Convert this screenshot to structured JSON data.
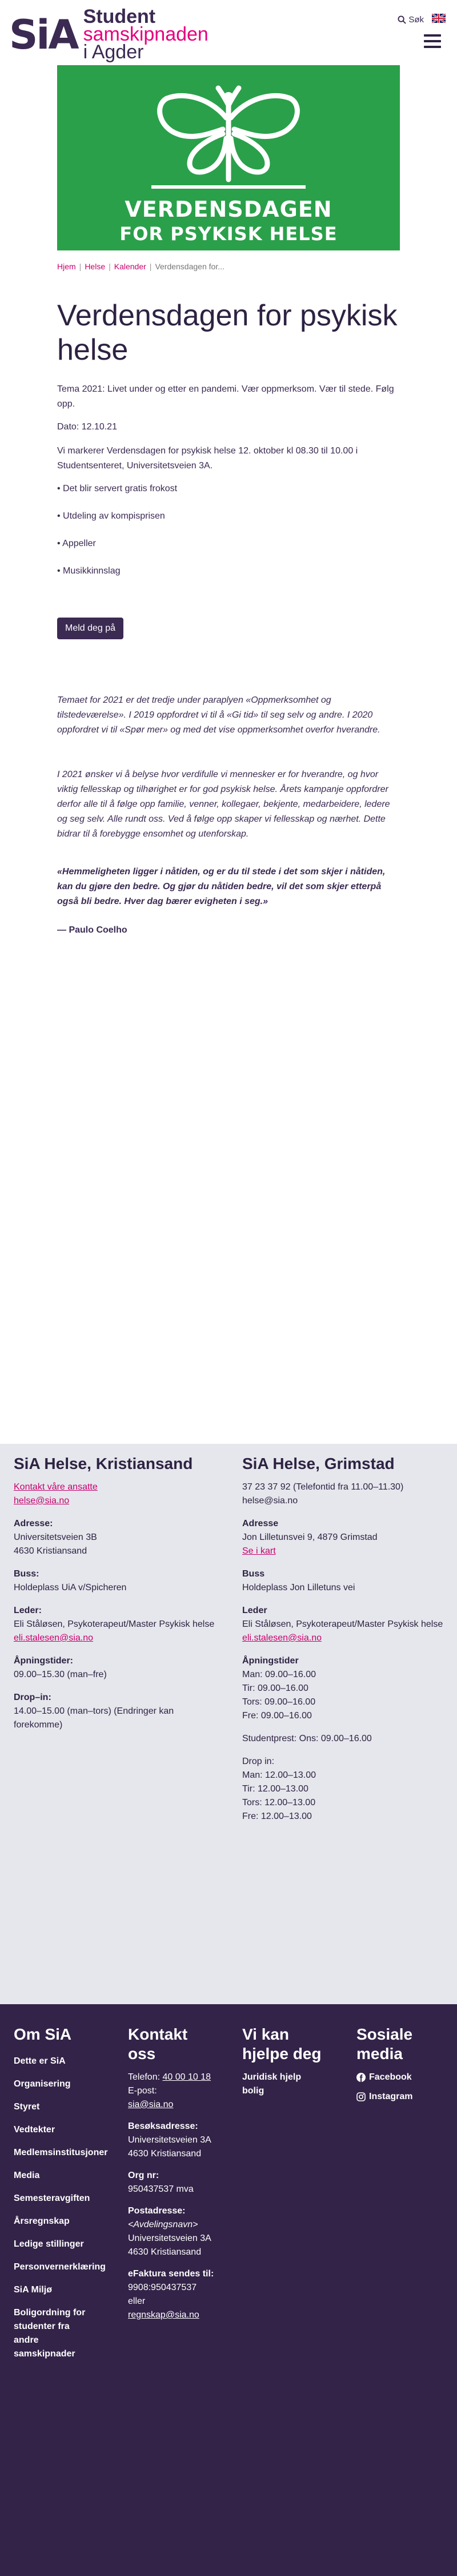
{
  "header": {
    "logo_mark": "SiA",
    "logo_line1": "Student",
    "logo_line2": "samskipnaden",
    "logo_line3": "i Agder",
    "search_label": "Søk"
  },
  "hero": {
    "line1": "VERDENSDAGEN",
    "line2": "FOR PSYKISK HELSE"
  },
  "breadcrumb": [
    "Hjem",
    "Helse",
    "Kalender",
    "Verdensdagen for..."
  ],
  "article": {
    "title": "Verdensdagen for psykisk helse",
    "intro": "Tema 2021: Livet under og etter en pandemi. Vær oppmerksom. Vær til stede. Følg opp.",
    "date": "Dato: 12.10.21",
    "body": "Vi markerer Verdensdagen for psykisk helse 12. oktober kl 08.30 til 10.00 i Studentsenteret, Universitetsveien 3A.",
    "bullets": [
      "Det blir servert gratis frokost",
      "Utdeling av kompisprisen",
      "Appeller",
      "Musikkinnslag"
    ],
    "button": "Meld deg på",
    "italic1": "Temaet for 2021 er det tredje under paraplyen «Oppmerksomhet og tilstedeværelse». I 2019 oppfordret vi til å «Gi tid» til seg selv og andre. I 2020 oppfordret vi til «Spør mer» og med det vise oppmerksomhet overfor hverandre.",
    "italic2": "I 2021 ønsker vi å belyse hvor verdifulle vi mennesker er for hverandre, og hvor viktig fellesskap og tilhørighet er for god psykisk helse. Årets kampanje oppfordrer derfor alle til å følge opp familie, venner, kollegaer, bekjente, medarbeidere, ledere og seg selv. Alle rundt oss. Ved å følge opp skaper vi fellesskap og nærhet. Dette bidrar til å forebygge ensomhet og utenforskap.",
    "quote": "«Hemmeligheten ligger i nåtiden, og er du til stede i det som skjer i nåtiden, kan du gjøre den bedre. Og gjør du nåtiden bedre, vil det som skjer etterpå også bli bedre. Hver dag bærer evigheten i seg.»",
    "author": "— Paulo Coelho"
  },
  "contact_left": {
    "title": "SiA Helse, Kristiansand",
    "contact_link": "Kontakt våre ansatte",
    "email": "helse@sia.no",
    "address_label": "Adresse:",
    "address1": "Universitetsveien 3B",
    "address2": "4630 Kristiansand",
    "bus_label": "Buss:",
    "bus": "Holdeplass UiA v/Spicheren",
    "leader_label": "Leder:",
    "leader": "Eli Ståløsen, Psykoterapeut/Master Psykisk helse",
    "leader_email": "eli.stalesen@sia.no",
    "hours_label": "Åpningstider:",
    "hours": "09.00–15.30 (man–fre)",
    "dropin_label": "Drop–in:",
    "dropin": "14.00–15.00 (man–tors) (Endringer kan forekomme)"
  },
  "contact_right": {
    "title": "SiA Helse, Grimstad",
    "phone": "37 23 37 92 (Telefontid fra 11.00–11.30)",
    "email": "helse@sia.no",
    "address_label": "Adresse",
    "address": "Jon Lilletunsvei 9, 4879 Grimstad",
    "map_link": "Se i kart",
    "bus_label": "Buss",
    "bus": "Holdeplass Jon Lilletuns vei",
    "leader_label": "Leder",
    "leader": "Eli Ståløsen, Psykoterapeut/Master Psykisk helse",
    "leader_email": "eli.stalesen@sia.no",
    "hours_label": "Åpningstider",
    "hours": [
      "Man: 09.00–16.00",
      "Tir: 09.00–16.00",
      "Tors: 09.00–16.00",
      "Fre: 09.00–16.00"
    ],
    "studentprest": "Studentprest: Ons: 09.00–16.00",
    "dropin_label": "Drop in:",
    "dropin": [
      "Man: 12.00–13.00",
      "Tir: 12.00–13.00",
      "Tors: 12.00–13.00",
      "Fre: 12.00–13.00"
    ]
  },
  "footer": {
    "col1_title": "Om SiA",
    "col1_links": [
      "Dette er SiA",
      "Organisering",
      "Styret",
      "Vedtekter",
      "Medlemsinstitusjoner",
      "Media",
      "Semesteravgiften",
      "Årsregnskap",
      "Ledige stillinger",
      "Personvernerklæring",
      "SiA Miljø",
      "Boligordning for studenter fra andre samskipnader"
    ],
    "col2_title": "Kontakt oss",
    "phone_label": "Telefon:",
    "phone": "40 00 10 18",
    "email_label": "E-post:",
    "email": "sia@sia.no",
    "visit_label": "Besøksadresse:",
    "visit1": "Universitetsveien 3A",
    "visit2": "4630 Kristiansand",
    "org_label": "Org nr:",
    "org": "950437537 mva",
    "post_label": "Postadresse:",
    "post1": "<Avdelingsnavn>",
    "post2": "Universitetsveien 3A",
    "post3": "4630 Kristiansand",
    "efaktura_label": "eFaktura sendes til:",
    "efaktura1": "9908:950437537",
    "efaktura2": "eller",
    "efaktura3": "regnskap@sia.no",
    "col3_title": "Vi kan hjelpe deg",
    "col3_links": [
      "Juridisk hjelp",
      "bolig"
    ],
    "col4_title": "Sosiale media",
    "facebook": "Facebook",
    "instagram": "Instagram"
  }
}
